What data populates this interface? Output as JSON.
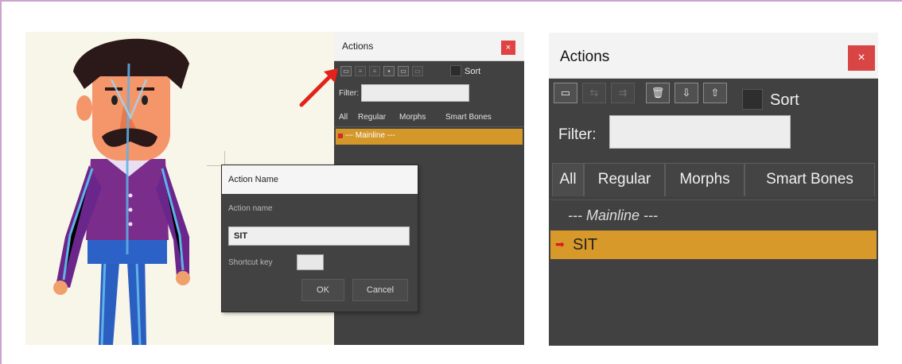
{
  "left_panel": {
    "title": "Actions",
    "close": "×",
    "sort": "Sort",
    "filter_label": "Filter:",
    "tabs": [
      "All",
      "Regular",
      "Morphs",
      "Smart Bones"
    ],
    "mainline": "--- Mainline ---"
  },
  "dialog": {
    "title": "Action Name",
    "action_name_label": "Action name",
    "action_name_value": "SIT",
    "shortcut_label": "Shortcut key",
    "ok": "OK",
    "cancel": "Cancel"
  },
  "right_panel": {
    "title": "Actions",
    "close": "×",
    "sort": "Sort",
    "filter_label": "Filter:",
    "filter_value": "",
    "tabs": [
      "All",
      "Regular",
      "Morphs",
      "Smart Bones"
    ],
    "mainline": "--- Mainline ---",
    "selected_action": "SIT",
    "toolbar_icons": [
      "new-action-icon",
      "insert-icon",
      "merge-icon",
      "delete-icon",
      "import-icon",
      "export-icon"
    ]
  },
  "colors": {
    "panel_bg": "#414141",
    "highlight": "#d8992b",
    "close_red": "#d94545",
    "arrow_red": "#e2231a",
    "frame": "#c9a5cd"
  }
}
